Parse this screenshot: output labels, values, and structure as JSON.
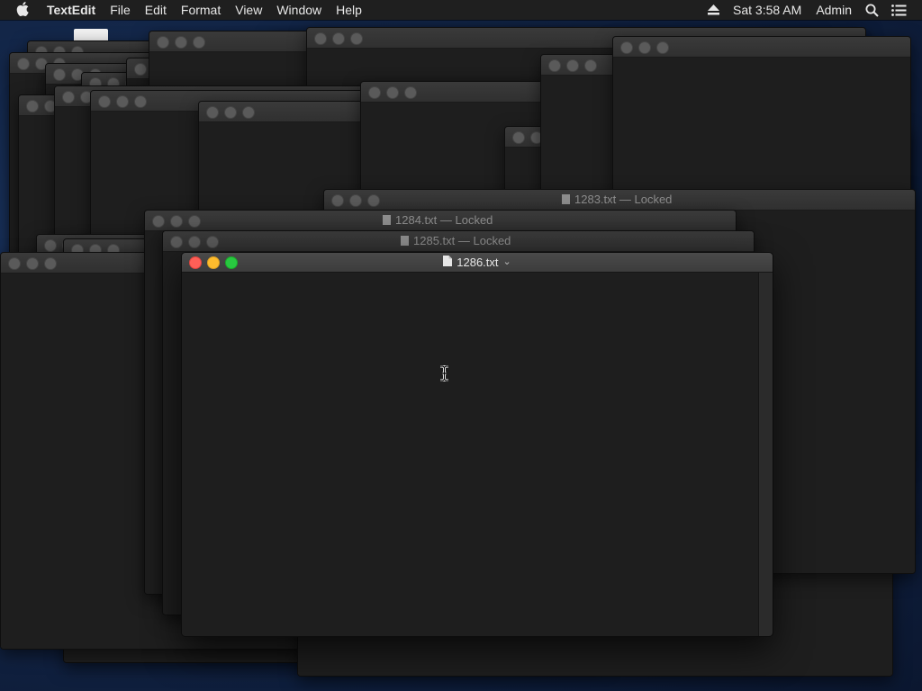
{
  "menubar": {
    "app_name": "TextEdit",
    "items": [
      "File",
      "Edit",
      "Format",
      "View",
      "Window",
      "Help"
    ],
    "clock": "Sat 3:58 AM",
    "user": "Admin",
    "icons": [
      "apple-icon",
      "eject-icon",
      "spotlight-search-icon",
      "notification-center-icon"
    ]
  },
  "windows": {
    "front": {
      "title": "1286.txt",
      "title_chevron": "⌄",
      "editor_text": ""
    },
    "background_titles": [
      {
        "title": "1283.txt — Locked"
      },
      {
        "title": "1284.txt — Locked"
      },
      {
        "title": "1285.txt — Locked"
      }
    ]
  },
  "colors": {
    "close": "#fe5f57",
    "minimize": "#febc2e",
    "zoom": "#28c840",
    "window_bg": "#1f1f1f",
    "menubar_bg": "#1f1f1f"
  }
}
